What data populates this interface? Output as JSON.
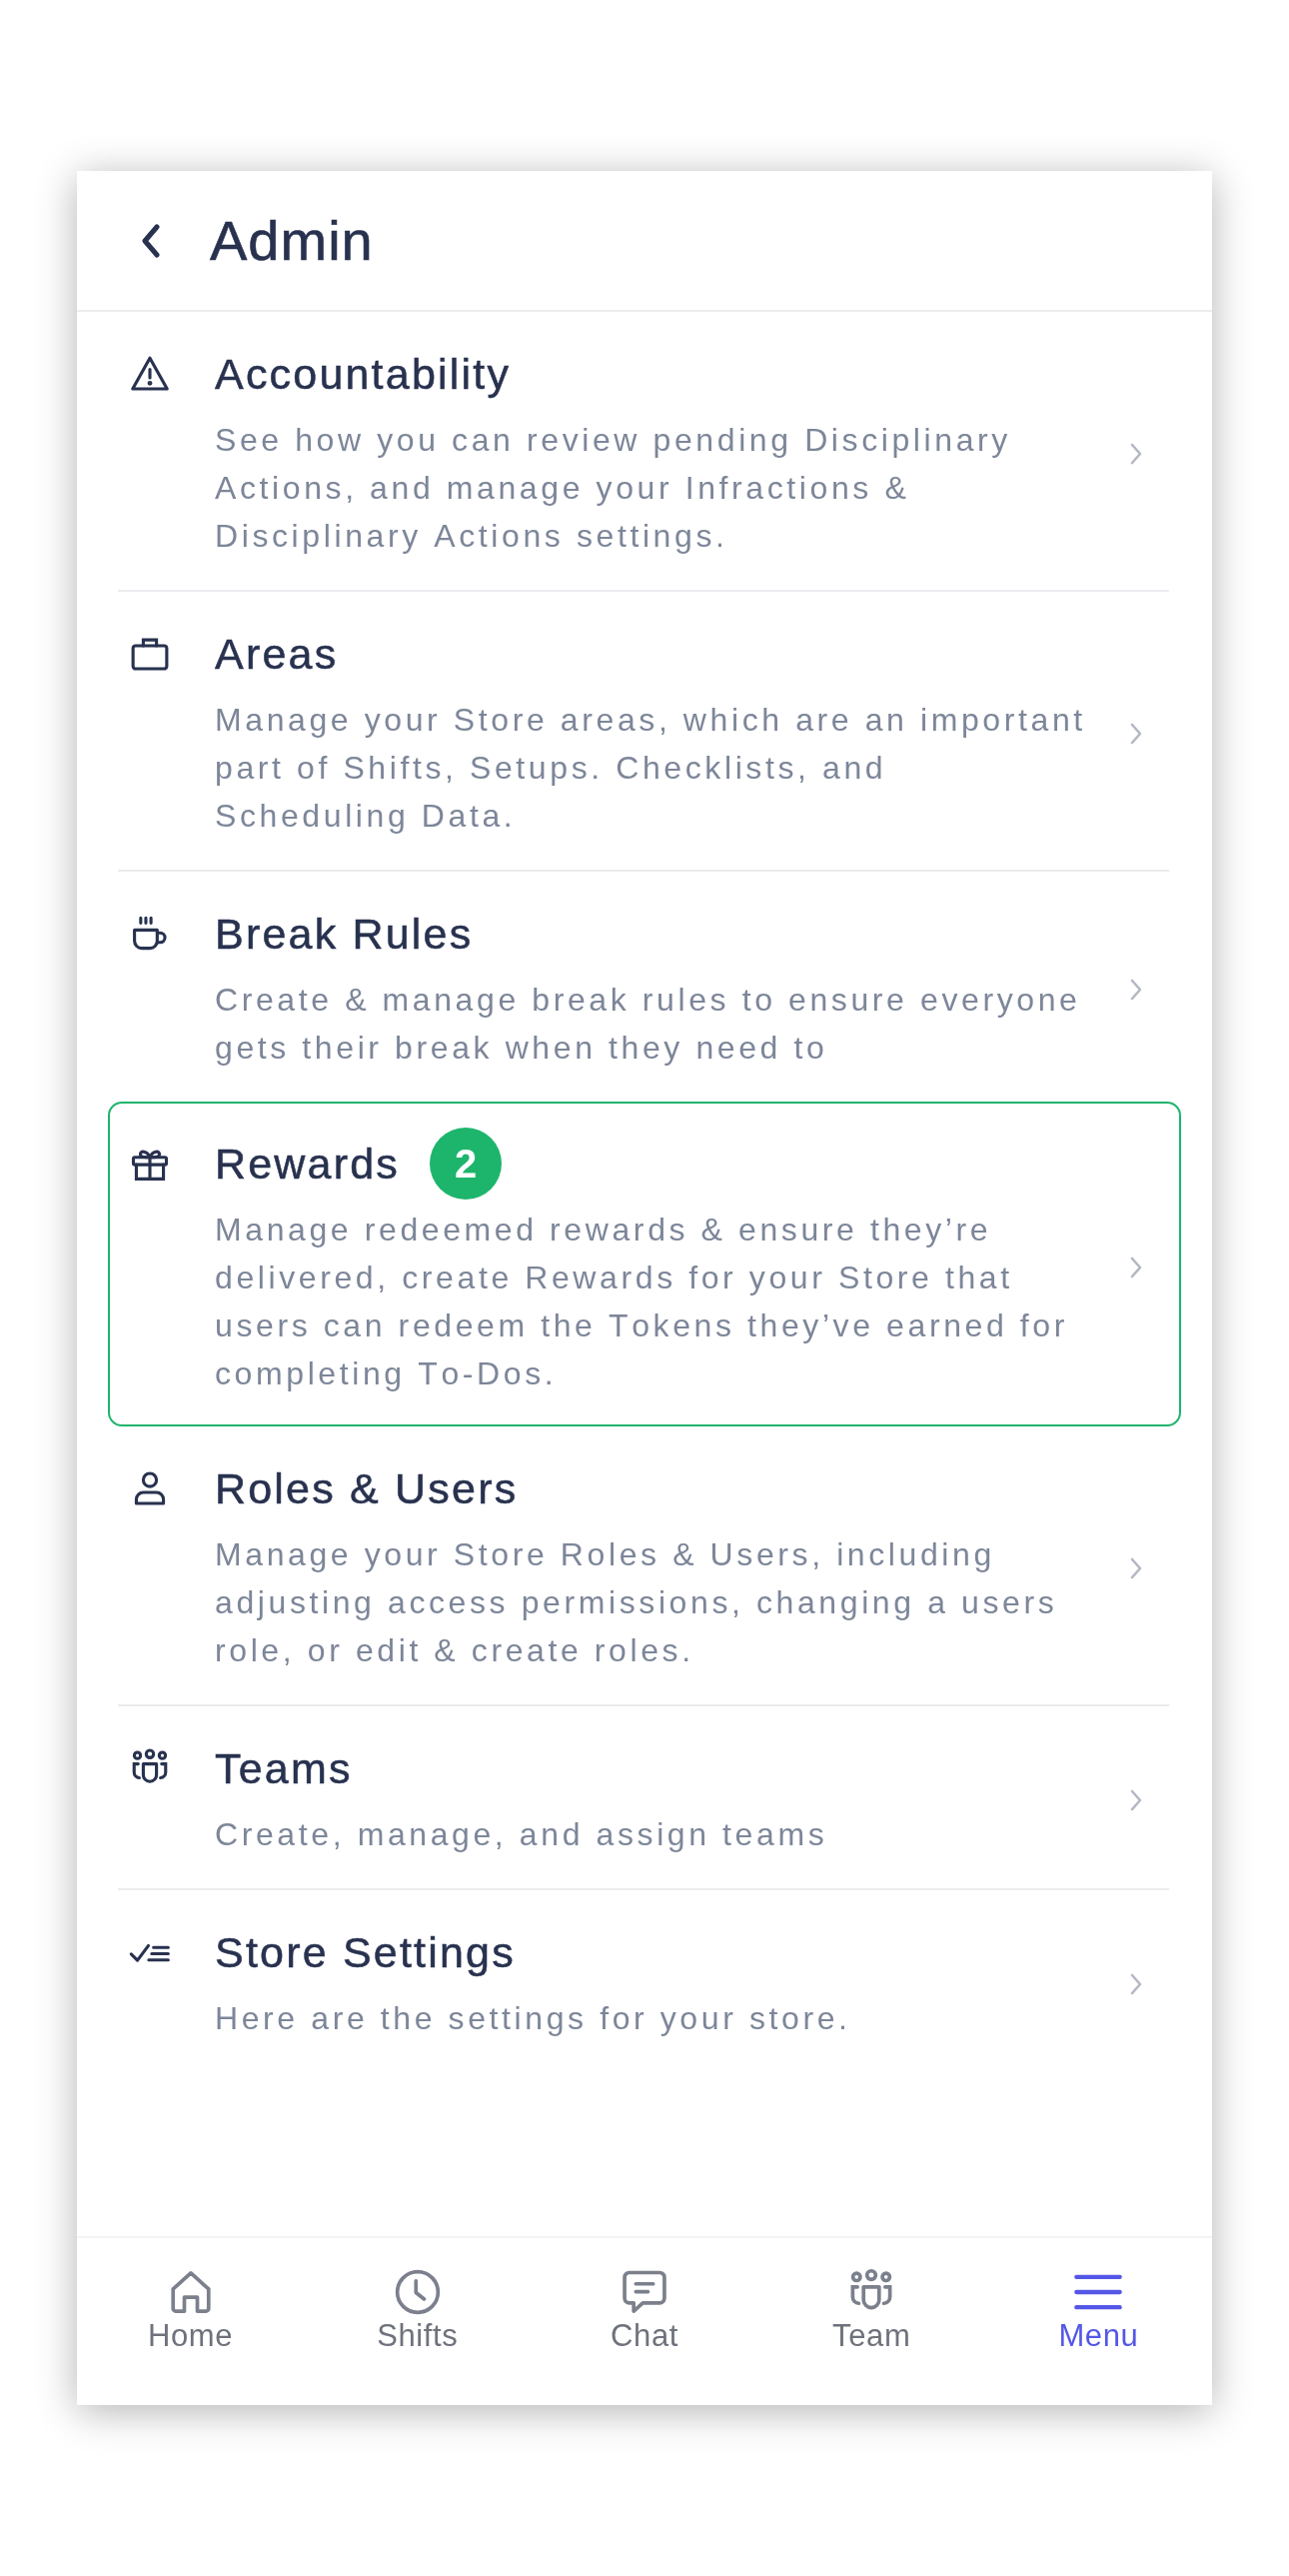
{
  "header": {
    "title": "Admin"
  },
  "items": [
    {
      "title": "Accountability",
      "description": "See how you can review pending Disciplinary Actions, and manage your Infractions & Disciplinary Actions settings.",
      "highlighted": false
    },
    {
      "title": "Areas",
      "description": "Manage your Store areas, which are an important part of Shifts, Setups. Checklists, and Scheduling Data.",
      "highlighted": false
    },
    {
      "title": "Break Rules",
      "description": "Create & manage break rules to ensure everyone gets their break when they need to",
      "highlighted": false
    },
    {
      "title": "Rewards",
      "description": "Manage redeemed rewards & ensure they’re delivered, create Rewards for your Store that users can redeem the Tokens they’ve earned for completing To-Dos.",
      "highlighted": true,
      "badge": "2"
    },
    {
      "title": "Roles & Users",
      "description": "Manage your Store Roles & Users, including adjusting access permissions, changing a users role, or edit & create roles.",
      "highlighted": false
    },
    {
      "title": "Teams",
      "description": "Create, manage, and assign teams",
      "highlighted": false
    },
    {
      "title": "Store Settings",
      "description": "Here are the settings for your store.",
      "highlighted": false
    }
  ],
  "tab_bar": [
    {
      "label": "Home",
      "selected": false
    },
    {
      "label": "Shifts",
      "selected": false
    },
    {
      "label": "Chat",
      "selected": false
    },
    {
      "label": "Team",
      "selected": false
    },
    {
      "label": "Menu",
      "selected": true
    }
  ]
}
